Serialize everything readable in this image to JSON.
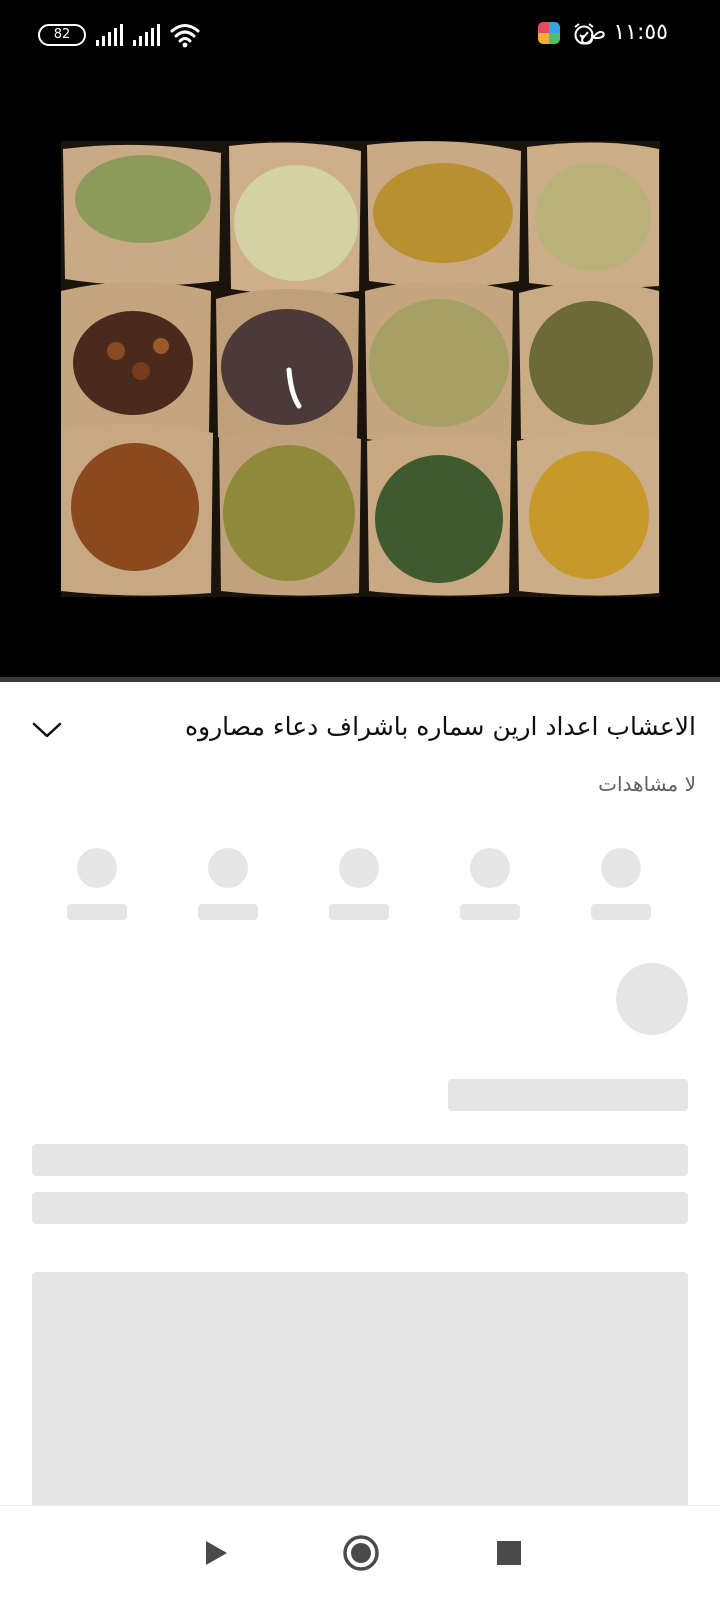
{
  "status_bar": {
    "battery": "82",
    "time": "١١:٥٥ ص"
  },
  "video": {
    "title": "الاعشاب اعداد ارين سماره باشراف دعاء مصاروه",
    "views": "لا مشاهدات",
    "progress": 0.0
  },
  "colors": {
    "progress_played": "#ff0000",
    "skeleton": "#e5e5e5"
  },
  "icons": {
    "expand": "chevron-down-icon",
    "nav_back": "play-triangle-icon",
    "nav_home": "circle-icon",
    "nav_recents": "square-icon"
  }
}
